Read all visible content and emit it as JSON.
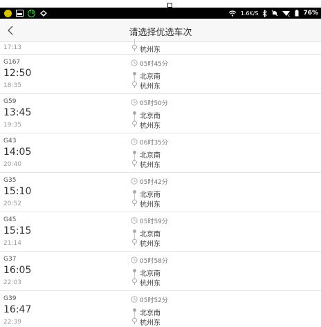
{
  "status_bar": {
    "net_speed": "1.6K/S",
    "battery": "76%",
    "badge": "76"
  },
  "header": {
    "title": "请选择优选车次"
  },
  "partial": {
    "arr_time": "17:13",
    "to": "杭州东"
  },
  "trains": [
    {
      "no": "G167",
      "dep": "12:50",
      "arr": "18:35",
      "duration": "05时45分",
      "from": "北京南",
      "to": "杭州东"
    },
    {
      "no": "G59",
      "dep": "13:45",
      "arr": "19:35",
      "duration": "05时50分",
      "from": "北京南",
      "to": "杭州东"
    },
    {
      "no": "G43",
      "dep": "14:05",
      "arr": "20:40",
      "duration": "06时35分",
      "from": "北京南",
      "to": "杭州东"
    },
    {
      "no": "G35",
      "dep": "15:10",
      "arr": "20:52",
      "duration": "05时42分",
      "from": "北京南",
      "to": "杭州东"
    },
    {
      "no": "G45",
      "dep": "15:15",
      "arr": "21:14",
      "duration": "05时59分",
      "from": "北京南",
      "to": "杭州东"
    },
    {
      "no": "G37",
      "dep": "16:05",
      "arr": "22:03",
      "duration": "05时58分",
      "from": "北京南",
      "to": "杭州东"
    },
    {
      "no": "G39",
      "dep": "16:47",
      "arr": "22:39",
      "duration": "05时52分",
      "from": "北京南",
      "to": "杭州东"
    }
  ]
}
